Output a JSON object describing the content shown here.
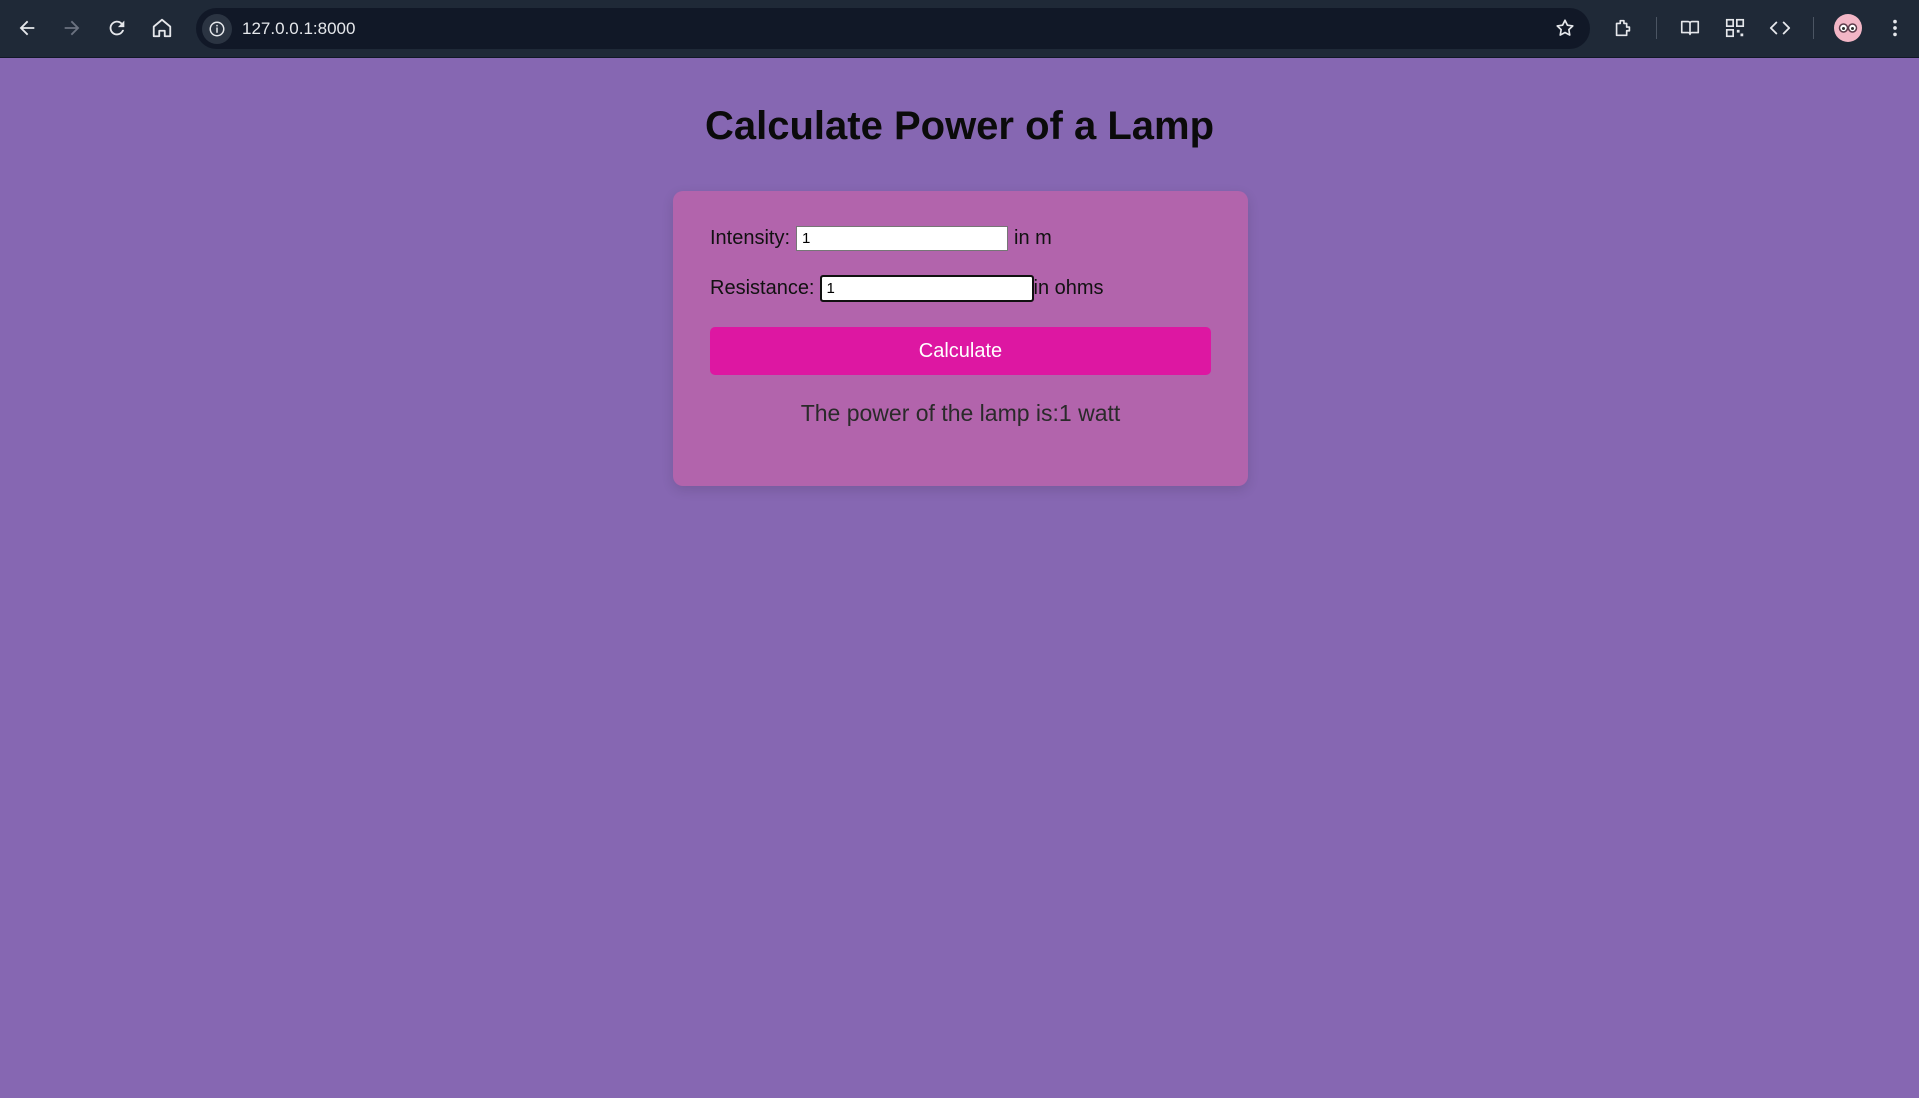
{
  "browser": {
    "url": "127.0.0.1:8000"
  },
  "page": {
    "title": "Calculate Power of a Lamp",
    "form": {
      "intensity_label": "Intensity:",
      "intensity_value": "1",
      "intensity_unit": "in m",
      "resistance_label": "Resistance:",
      "resistance_value": "1",
      "resistance_unit": "in ohms",
      "calculate_label": "Calculate"
    },
    "result": "The power of the lamp is:1 watt"
  },
  "colors": {
    "background": "#8667b2",
    "card": "#b264ac",
    "button": "#dd17a2"
  }
}
